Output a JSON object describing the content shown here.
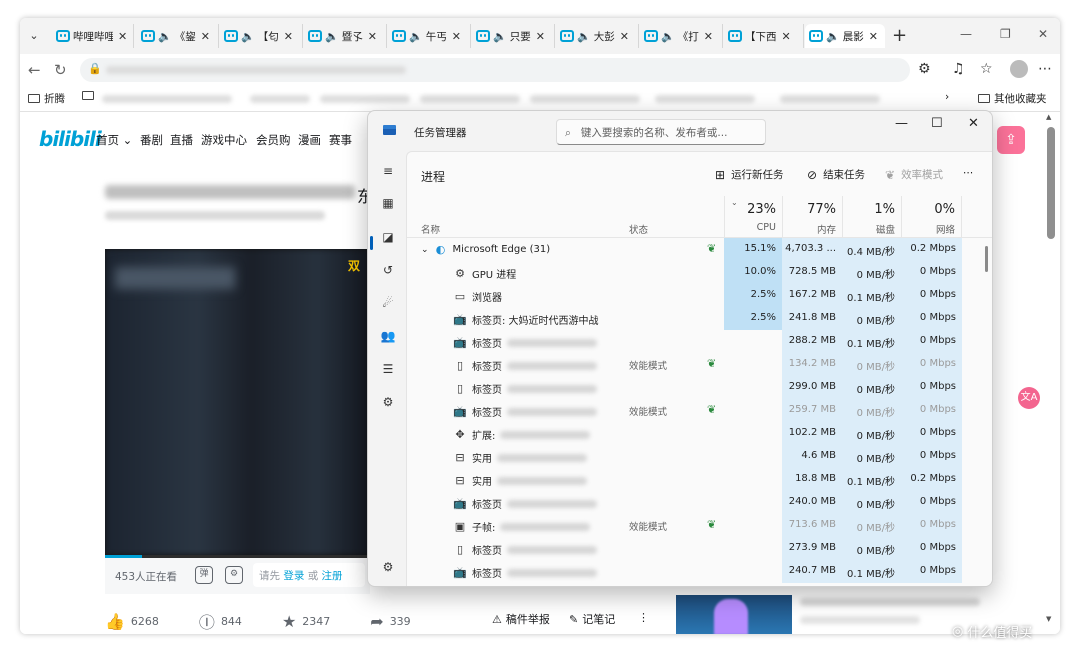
{
  "browser": {
    "tabs": [
      {
        "title": "哔哩哔哩",
        "audio": false,
        "active": false
      },
      {
        "title": "《鋆",
        "audio": true,
        "active": false
      },
      {
        "title": "【匂",
        "audio": true,
        "active": false
      },
      {
        "title": "暨孓",
        "audio": true,
        "active": false
      },
      {
        "title": "午丐",
        "audio": true,
        "active": false
      },
      {
        "title": "只要",
        "audio": true,
        "active": false
      },
      {
        "title": "大彭",
        "audio": true,
        "active": false
      },
      {
        "title": "《打",
        "audio": true,
        "active": false
      },
      {
        "title": "【下西",
        "audio": false,
        "active": false
      },
      {
        "title": "晨影",
        "audio": true,
        "active": true
      }
    ],
    "close_glyph": "✕",
    "speaker_glyph": "🔈",
    "favorites": {
      "first": "折腾",
      "last": "其他收藏夹"
    }
  },
  "bili": {
    "logo": "bilibili",
    "nav": [
      "首页",
      "番剧",
      "直播",
      "游戏中心",
      "会员购",
      "漫画",
      "赛事"
    ],
    "title_visible_char": "东",
    "video_overlay_text": "双",
    "video_progress": 0.14,
    "viewers": "453人正在看",
    "danmaku_prompt": "请先",
    "login": "登录",
    "or": "或",
    "register": "注册",
    "likes": "6268",
    "coins": "844",
    "favs": "2347",
    "shares": "339",
    "report": "稿件举报",
    "notes": "记笔记"
  },
  "tm": {
    "title": "任务管理器",
    "search_placeholder": "键入要搜索的名称、发布者或...",
    "section": "进程",
    "cmd_run": "运行新任务",
    "cmd_end": "结束任务",
    "cmd_eff": "效率模式",
    "col_name": "名称",
    "col_status": "状态",
    "cpu_pct": "23%",
    "cpu_lbl": "CPU",
    "mem_pct": "77%",
    "mem_lbl": "内存",
    "disk_pct": "1%",
    "disk_lbl": "磁盘",
    "net_pct": "0%",
    "net_lbl": "网络",
    "rows": [
      {
        "icon": "edge-icon",
        "name": "Microsoft Edge (31)",
        "blur": 0,
        "status": "",
        "leaf": true,
        "cpu": "15.1%",
        "mem": "4,703.3 ...",
        "disk": "0.4 MB/秒",
        "net": "0.2 Mbps",
        "dim": false,
        "level": 0
      },
      {
        "icon": "gear-icon",
        "name": "GPU 进程",
        "blur": 0,
        "status": "",
        "leaf": false,
        "cpu": "10.0%",
        "mem": "728.5 MB",
        "disk": "0 MB/秒",
        "net": "0 Mbps",
        "dim": false,
        "level": 1
      },
      {
        "icon": "window-icon",
        "name": "浏览器",
        "blur": 0,
        "status": "",
        "leaf": false,
        "cpu": "2.5%",
        "mem": "167.2 MB",
        "disk": "0.1 MB/秒",
        "net": "0 Mbps",
        "dim": false,
        "level": 1
      },
      {
        "icon": "bilibili-icon",
        "name": "标签页: 大妈近时代西游中战",
        "blur": 0,
        "status": "",
        "leaf": false,
        "cpu": "2.5%",
        "mem": "241.8 MB",
        "disk": "0 MB/秒",
        "net": "0 Mbps",
        "dim": false,
        "level": 1
      },
      {
        "icon": "bilibili-icon",
        "name": "标签页",
        "blur": 90,
        "status": "",
        "leaf": false,
        "cpu": "0%",
        "mem": "288.2 MB",
        "disk": "0.1 MB/秒",
        "net": "0 Mbps",
        "dim": false,
        "level": 1
      },
      {
        "icon": "page-icon",
        "name": "标签页",
        "blur": 90,
        "status": "效能模式",
        "leaf": true,
        "cpu": "0%",
        "mem": "134.2 MB",
        "disk": "0 MB/秒",
        "net": "0 Mbps",
        "dim": true,
        "level": 1
      },
      {
        "icon": "page-icon",
        "name": "标签页",
        "blur": 90,
        "status": "",
        "leaf": false,
        "cpu": "0%",
        "mem": "299.0 MB",
        "disk": "0 MB/秒",
        "net": "0 Mbps",
        "dim": false,
        "level": 1
      },
      {
        "icon": "bilibili-icon",
        "name": "标签页",
        "blur": 90,
        "status": "效能模式",
        "leaf": true,
        "cpu": "0%",
        "mem": "259.7 MB",
        "disk": "0 MB/秒",
        "net": "0 Mbps",
        "dim": true,
        "level": 1
      },
      {
        "icon": "puzzle-icon",
        "name": "扩展:",
        "blur": 90,
        "status": "",
        "leaf": false,
        "cpu": "0%",
        "mem": "102.2 MB",
        "disk": "0 MB/秒",
        "net": "0 Mbps",
        "dim": false,
        "level": 1
      },
      {
        "icon": "suitcase-icon",
        "name": "实用",
        "blur": 90,
        "status": "",
        "leaf": false,
        "cpu": "0%",
        "mem": "4.6 MB",
        "disk": "0 MB/秒",
        "net": "0 Mbps",
        "dim": false,
        "level": 1
      },
      {
        "icon": "suitcase-icon",
        "name": "实用",
        "blur": 90,
        "status": "",
        "leaf": false,
        "cpu": "0%",
        "mem": "18.8 MB",
        "disk": "0.1 MB/秒",
        "net": "0.2 Mbps",
        "dim": false,
        "level": 1
      },
      {
        "icon": "bilibili-icon",
        "name": "标签页",
        "blur": 90,
        "status": "",
        "leaf": false,
        "cpu": "0%",
        "mem": "240.0 MB",
        "disk": "0 MB/秒",
        "net": "0 Mbps",
        "dim": false,
        "level": 1
      },
      {
        "icon": "frame-icon",
        "name": "子帧:",
        "blur": 90,
        "status": "效能模式",
        "leaf": true,
        "cpu": "0%",
        "mem": "713.6 MB",
        "disk": "0 MB/秒",
        "net": "0 Mbps",
        "dim": true,
        "level": 1
      },
      {
        "icon": "page-icon",
        "name": "标签页",
        "blur": 90,
        "status": "",
        "leaf": false,
        "cpu": "0%",
        "mem": "273.9 MB",
        "disk": "0 MB/秒",
        "net": "0 Mbps",
        "dim": false,
        "level": 1
      },
      {
        "icon": "bilibili-icon",
        "name": "标签页",
        "blur": 90,
        "status": "",
        "leaf": false,
        "cpu": "0%",
        "mem": "240.7 MB",
        "disk": "0.1 MB/秒",
        "net": "0 Mbps",
        "dim": false,
        "level": 1
      }
    ]
  },
  "watermark": "什么值得买",
  "colors": {
    "bili_blue": "#00a1d6",
    "bili_pink": "#fb7299",
    "cpu_heat": "#bfe0f5",
    "mem_heat": "#dcedf9"
  }
}
